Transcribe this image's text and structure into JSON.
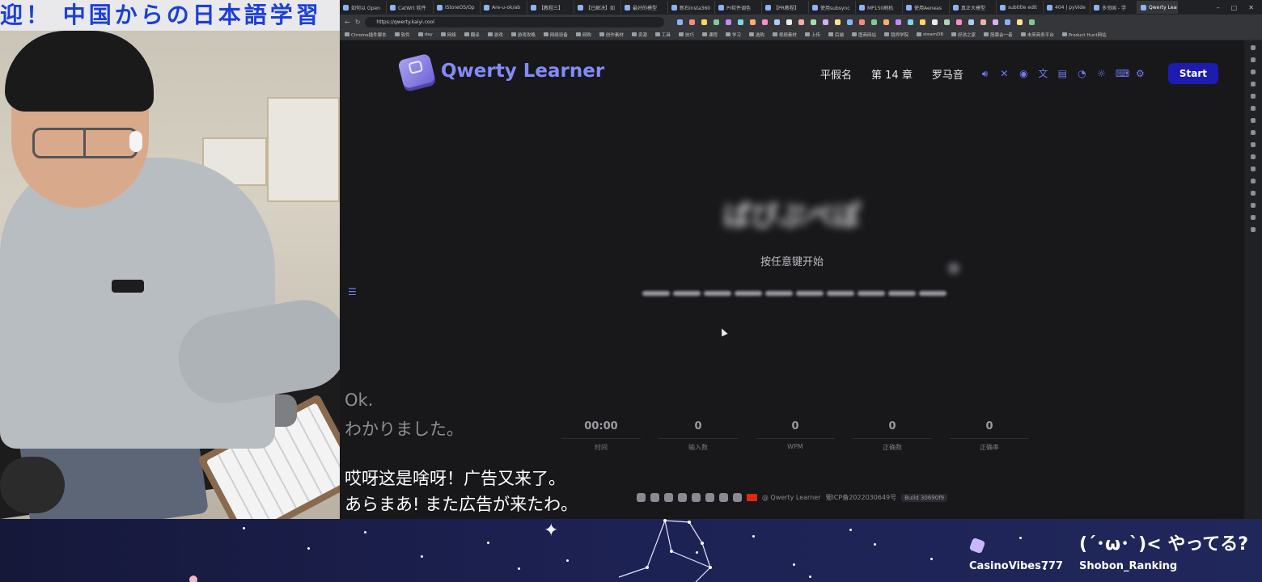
{
  "stream_banner": "迎！ 中国からの日本語学習",
  "browser": {
    "tabs": [
      {
        "label": "如何以 Open",
        "active": false
      },
      {
        "label": "CatWrt 软件",
        "active": false
      },
      {
        "label": "iStoreOS/Op",
        "active": false
      },
      {
        "label": "Are-u-ok/ab",
        "active": false
      },
      {
        "label": "【教程三】",
        "active": false
      },
      {
        "label": "【已解决】如",
        "active": false
      },
      {
        "label": "最好的模型",
        "active": false
      },
      {
        "label": "新石insta360",
        "active": false
      },
      {
        "label": "Pr软件调色",
        "active": false
      },
      {
        "label": "【PR教程】",
        "active": false
      },
      {
        "label": "使用subsync",
        "active": false
      },
      {
        "label": "MP150刷机",
        "active": false
      },
      {
        "label": "使用Aeneas",
        "active": false
      },
      {
        "label": "真正大模型",
        "active": false
      },
      {
        "label": "subtitle edit",
        "active": false
      },
      {
        "label": "404 | pyVide",
        "active": false
      },
      {
        "label": "多邻国 - 学",
        "active": false
      },
      {
        "label": "Qwerty Lear",
        "active": true
      }
    ],
    "url": "https://qwerty.kaiyi.cool",
    "bookmarks": [
      "Chrome插件脚本",
      "软件",
      "day",
      "网络",
      "翻译",
      "游戏",
      "游戏攻略",
      "网络设备",
      "网购",
      "创作素材",
      "资源",
      "工具",
      "技巧",
      "课程",
      "学习",
      "选购",
      "视频素材",
      "上传",
      "后端",
      "图商网站",
      "镜师学院",
      "steamDB",
      "好孩之家",
      "股票会一者",
      "未来商务平台",
      "Product Hunt网站"
    ]
  },
  "app": {
    "name": "Qwerty Learner",
    "nav": {
      "dict": "平假名",
      "chapter": "第 14 章",
      "mode": "罗马音"
    },
    "toolbar_icons": [
      "speaker-icon",
      "shuffle-off-icon",
      "eye-icon",
      "translate-icon",
      "book-icon",
      "chart-icon",
      "sun-icon",
      "keyboard-icon",
      "gear-icon"
    ],
    "start_label": "Start",
    "word": "ぱぴぷぺぽ",
    "hint": "按任意键开始",
    "blank_count": 10,
    "stats": [
      {
        "value": "00:00",
        "label": "时间"
      },
      {
        "value": "0",
        "label": "输入数"
      },
      {
        "value": "0",
        "label": "WPM"
      },
      {
        "value": "0",
        "label": "正确数"
      },
      {
        "value": "0",
        "label": "正确率"
      }
    ],
    "footer": {
      "credit": "@ Qwerty Learner",
      "icp": "蜀ICP备2022030649号",
      "build": "Build 30690f9"
    }
  },
  "subtitles": {
    "prev_line1": "Ok.",
    "prev_line2": "わかりました。",
    "cur_line1": "哎呀这是啥呀！广告又来了。",
    "cur_line2": "あらまあ! また広告が来たわ。"
  },
  "overlay": {
    "user1_name": "CasinoVibes777",
    "user2_message": "(´･ω･`)< やってる?",
    "user2_name": "Shobon_Ranking"
  },
  "colors": {
    "accent": "#818cf8",
    "start_button": "#1e1bb0",
    "page_bg": "#18181b"
  }
}
